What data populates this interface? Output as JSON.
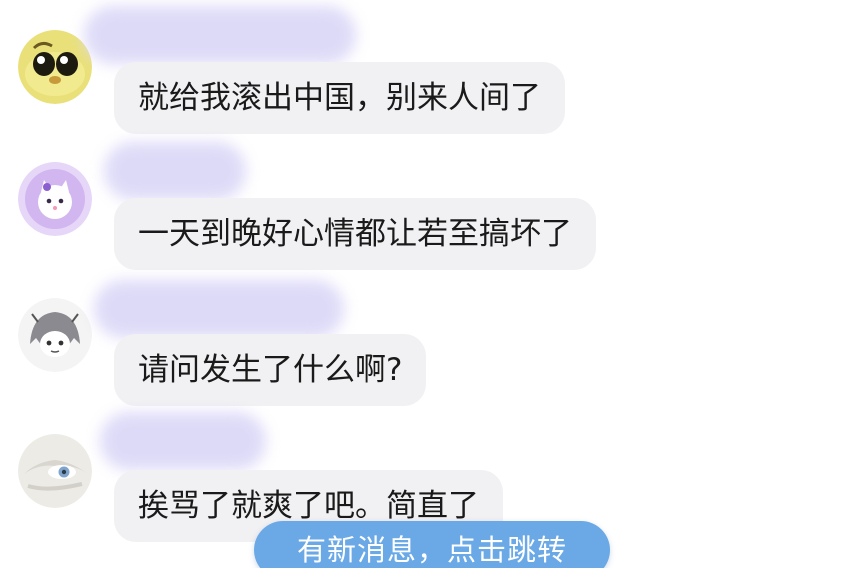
{
  "messages": [
    {
      "avatar": "yellow-chick-avatar",
      "text": "就给我滚出中国，别来人间了"
    },
    {
      "avatar": "purple-cat-avatar",
      "text": "一天到晚好心情都让若至搞坏了"
    },
    {
      "avatar": "anime-girl-avatar",
      "text": "请问发生了什么啊?"
    },
    {
      "avatar": "blue-eye-avatar",
      "text": "挨骂了就爽了吧。简直了"
    }
  ],
  "toast": {
    "label": "有新消息，点击跳转"
  },
  "colors": {
    "bubble_bg": "#f1f1f3",
    "name_blur": "#dcd9f7",
    "toast_bg": "#6aa9e6",
    "text": "#1a1a1a"
  }
}
